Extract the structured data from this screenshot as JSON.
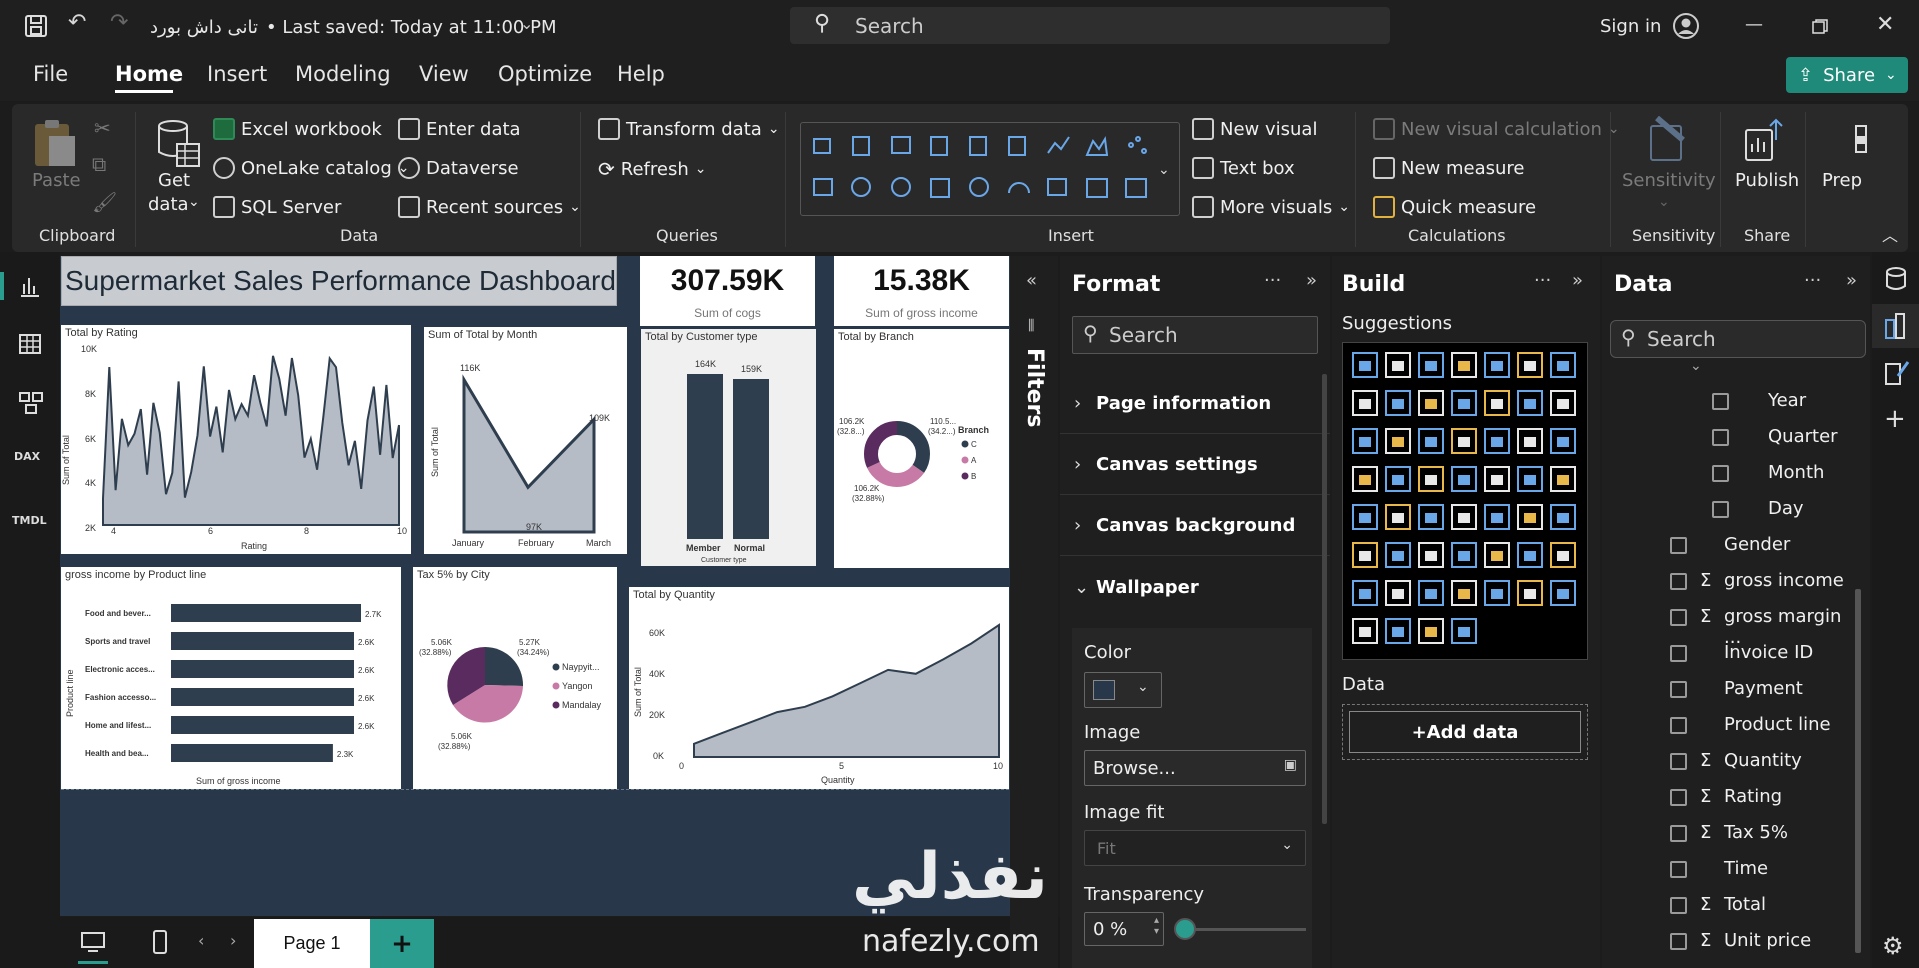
{
  "titlebar": {
    "title": "تانى داش بورد",
    "saved": "• Last saved: Today at 11:00 PM",
    "search_placeholder": "Search",
    "sign_in": "Sign in",
    "share": "Share"
  },
  "menu": [
    "File",
    "Home",
    "Insert",
    "Modeling",
    "View",
    "Optimize",
    "Help"
  ],
  "ribbon": {
    "clipboard": {
      "paste": "Paste",
      "group": "Clipboard"
    },
    "data": {
      "get_data_1": "Get",
      "get_data_2": "data",
      "excel": "Excel workbook",
      "onelake": "OneLake catalog",
      "sql": "SQL Server",
      "enter": "Enter data",
      "dataverse": "Dataverse",
      "recent": "Recent sources",
      "group": "Data"
    },
    "queries": {
      "transform": "Transform data",
      "refresh": "Refresh",
      "group": "Queries"
    },
    "insert": {
      "new_visual": "New visual",
      "text_box": "Text box",
      "more_visuals": "More visuals",
      "group": "Insert"
    },
    "calc": {
      "new_visual_calc": "New visual calculation",
      "new_measure": "New measure",
      "quick_measure": "Quick measure",
      "group": "Calculations"
    },
    "sensitivity": {
      "label": "Sensitivity",
      "group": "Sensitivity"
    },
    "share": {
      "publish": "Publish",
      "group": "Share"
    },
    "prep": "Prep"
  },
  "dashboard": {
    "title": "Supermarket Sales Performance Dashboard",
    "kpi1": {
      "value": "307.59K",
      "label": "Sum of cogs"
    },
    "kpi2": {
      "value": "15.38K",
      "label": "Sum of gross income"
    },
    "rating": {
      "title": "Total by Rating",
      "ylabel": "Sum of Total",
      "xlabel": "Rating",
      "yticks": [
        "10K",
        "8K",
        "6K",
        "4K",
        "2K"
      ],
      "xticks": [
        "4",
        "6",
        "8",
        "10"
      ]
    },
    "month": {
      "title": "Sum of Total by Month",
      "ylabel": "Sum of Total",
      "categories": [
        "January",
        "February",
        "March"
      ],
      "labels": [
        "116K",
        "97K",
        "109K"
      ]
    },
    "customer": {
      "title": "Total by Customer type",
      "xlabel": "Customer type",
      "categories": [
        "Member",
        "Normal"
      ],
      "labels": [
        "164K",
        "159K"
      ]
    },
    "branch": {
      "title": "Total by Branch",
      "legend_title": "Branch",
      "legend": [
        "C",
        "A",
        "B"
      ],
      "l1": "106.2K",
      "l1b": "(32.8...)",
      "l2": "110.5...",
      "l2b": "(34.2...)",
      "l3": "106.2K",
      "l3b": "(32.88%)"
    },
    "product": {
      "title": "gross income by Product line",
      "ylabel": "Product line",
      "xlabel": "Sum of gross income",
      "rows": [
        {
          "name": "Food and bever...",
          "value": "2.7K"
        },
        {
          "name": "Sports and travel",
          "value": "2.6K"
        },
        {
          "name": "Electronic acces...",
          "value": "2.6K"
        },
        {
          "name": "Fashion accesso...",
          "value": "2.6K"
        },
        {
          "name": "Home and lifest...",
          "value": "2.6K"
        },
        {
          "name": "Health and bea...",
          "value": "2.3K"
        }
      ]
    },
    "city": {
      "title": "Tax 5% by City",
      "legend": [
        "Naypyit...",
        "Yangon",
        "Mandalay"
      ],
      "l1": "5.06K",
      "l1b": "(32.88%)",
      "l2": "5.27K",
      "l2b": "(34.24%)",
      "l3": "5.06K",
      "l3b": "(32.88%)"
    },
    "quantity": {
      "title": "Total by Quantity",
      "ylabel": "Sum of Total",
      "xlabel": "Quantity",
      "yticks": [
        "60K",
        "40K",
        "20K",
        "0K"
      ],
      "xticks": [
        "0",
        "5",
        "10"
      ]
    }
  },
  "chart_data": [
    {
      "type": "area",
      "title": "Total by Rating",
      "xlabel": "Rating",
      "ylabel": "Sum of Total",
      "ylim": [
        0,
        10000
      ],
      "xlim": [
        4,
        10
      ]
    },
    {
      "type": "area",
      "title": "Sum of Total by Month",
      "ylabel": "Sum of Total",
      "categories": [
        "January",
        "February",
        "March"
      ],
      "values": [
        116000,
        97000,
        109000
      ]
    },
    {
      "type": "bar",
      "title": "Total by Customer type",
      "xlabel": "Customer type",
      "categories": [
        "Member",
        "Normal"
      ],
      "values": [
        164000,
        159000
      ]
    },
    {
      "type": "pie",
      "title": "Total by Branch",
      "categories": [
        "C",
        "A",
        "B"
      ],
      "values": [
        110500,
        106200,
        106200
      ]
    },
    {
      "type": "bar",
      "title": "gross income by Product line",
      "xlabel": "Sum of gross income",
      "ylabel": "Product line",
      "categories": [
        "Food and bever...",
        "Sports and travel",
        "Electronic acces...",
        "Fashion accesso...",
        "Home and lifest...",
        "Health and bea..."
      ],
      "values": [
        2700,
        2600,
        2600,
        2600,
        2600,
        2300
      ]
    },
    {
      "type": "pie",
      "title": "Tax 5% by City",
      "categories": [
        "Naypyit...",
        "Yangon",
        "Mandalay"
      ],
      "values": [
        5270,
        5060,
        5060
      ]
    },
    {
      "type": "area",
      "title": "Total by Quantity",
      "xlabel": "Quantity",
      "ylabel": "Sum of Total",
      "ylim": [
        0,
        60000
      ],
      "xlim": [
        0,
        10
      ]
    }
  ],
  "pagebar": {
    "page": "Page 1",
    "add": "+"
  },
  "filters": {
    "label": "Filters"
  },
  "format": {
    "title": "Format",
    "search": "Search",
    "sections": [
      "Page information",
      "Canvas settings",
      "Canvas background",
      "Wallpaper"
    ],
    "color_label": "Color",
    "image_label": "Image",
    "browse": "Browse...",
    "image_fit": "Image fit",
    "fit_value": "Fit",
    "transparency": "Transparency",
    "transparency_value": "0 %"
  },
  "build": {
    "title": "Build",
    "suggestions": "Suggestions",
    "data_label": "Data",
    "add_data": "+Add data"
  },
  "datapane": {
    "title": "Data",
    "search": "Search",
    "fields": [
      {
        "name": "Year",
        "sigma": false
      },
      {
        "name": "Quarter",
        "sigma": false
      },
      {
        "name": "Month",
        "sigma": false
      },
      {
        "name": "Day",
        "sigma": false
      },
      {
        "name": "Gender",
        "sigma": false
      },
      {
        "name": "gross income",
        "sigma": true
      },
      {
        "name": "gross margin ...",
        "sigma": true
      },
      {
        "name": "Invoice ID",
        "sigma": false
      },
      {
        "name": "Payment",
        "sigma": false
      },
      {
        "name": "Product line",
        "sigma": false
      },
      {
        "name": "Quantity",
        "sigma": true
      },
      {
        "name": "Rating",
        "sigma": true
      },
      {
        "name": "Tax 5%",
        "sigma": true
      },
      {
        "name": "Time",
        "sigma": false
      },
      {
        "name": "Total",
        "sigma": true
      },
      {
        "name": "Unit price",
        "sigma": true
      }
    ]
  },
  "watermark": {
    "arabic": "نفذلي",
    "latin": "nafezly.com"
  },
  "colors": {
    "accent": "#2a9d8f",
    "bar": "#2f3e4e",
    "area": "#b5bcc6",
    "pie_c": "#2f3e4e",
    "pie_a": "#c77aa6",
    "pie_b": "#5a2b5e",
    "canvas": "#283749"
  }
}
